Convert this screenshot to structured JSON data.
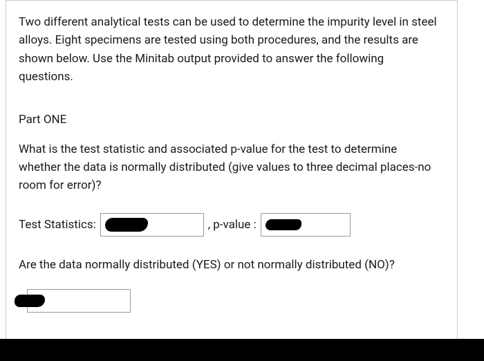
{
  "intro": "Two different analytical tests can be used to determine the impurity level in steel alloys. Eight specimens are tested using both procedures, and the results are shown below. Use the Minitab output provided to answer the following questions.",
  "part_label": "Part ONE",
  "question1": "What is the test statistic and associated p-value for the test to determine whether the data is normally distributed (give values to three decimal places-no room for error)?",
  "labels": {
    "test_stat": "Test Statistics:",
    "pvalue_sep": ", p-value :"
  },
  "inputs": {
    "test_stat_value": "",
    "pvalue_value": "",
    "distributed_value": ""
  },
  "question2": "Are the data normally distributed (YES) or not normally distributed (NO)?"
}
